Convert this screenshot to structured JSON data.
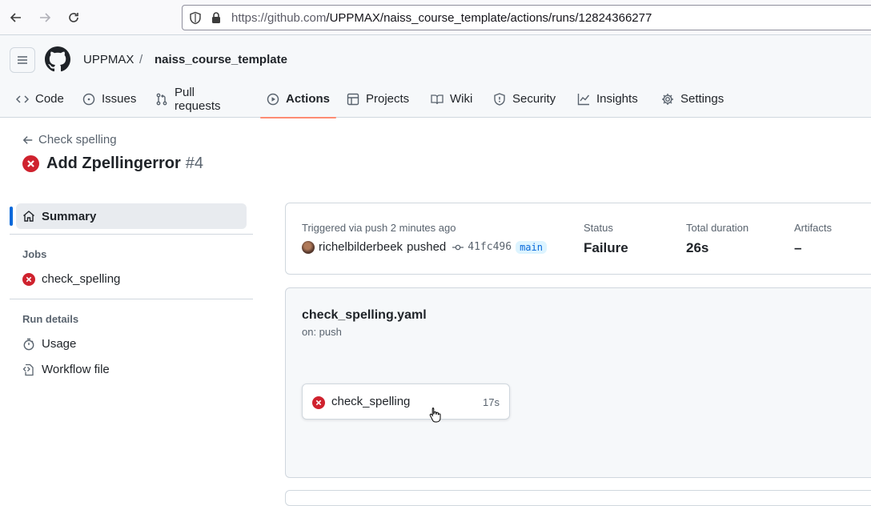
{
  "browser": {
    "url_host": "https://github.com",
    "url_path": "/UPPMAX/naiss_course_template/actions/runs/12824366277"
  },
  "header": {
    "owner": "UPPMAX",
    "separator": "/",
    "repo": "naiss_course_template"
  },
  "tabs": [
    {
      "label": "Code",
      "icon": "code-icon"
    },
    {
      "label": "Issues",
      "icon": "issue-icon"
    },
    {
      "label": "Pull requests",
      "icon": "pull-request-icon"
    },
    {
      "label": "Actions",
      "icon": "play-icon",
      "active": true
    },
    {
      "label": "Projects",
      "icon": "table-icon"
    },
    {
      "label": "Wiki",
      "icon": "book-icon"
    },
    {
      "label": "Security",
      "icon": "shield-icon"
    },
    {
      "label": "Insights",
      "icon": "graph-icon"
    },
    {
      "label": "Settings",
      "icon": "gear-icon"
    }
  ],
  "page": {
    "back_label": "Check spelling",
    "run_title": "Add Zpellingerror",
    "run_number": "#4"
  },
  "sidebar": {
    "summary_label": "Summary",
    "jobs_heading": "Jobs",
    "job_item": "check_spelling",
    "run_details_heading": "Run details",
    "usage_label": "Usage",
    "workflow_file_label": "Workflow file"
  },
  "summary": {
    "triggered_label": "Triggered via push 2 minutes ago",
    "actor": "richelbilderbeek",
    "action": "pushed",
    "commit_sha": "41fc496",
    "branch": "main",
    "status_label": "Status",
    "status_value": "Failure",
    "duration_label": "Total duration",
    "duration_value": "26s",
    "artifacts_label": "Artifacts",
    "artifacts_value": "–"
  },
  "workflow": {
    "file_name": "check_spelling.yaml",
    "trigger": "on: push",
    "job_name": "check_spelling",
    "job_duration": "17s"
  },
  "colors": {
    "failure": "#cf222e",
    "accent": "#0969da",
    "active_tab": "#fd8c73"
  }
}
